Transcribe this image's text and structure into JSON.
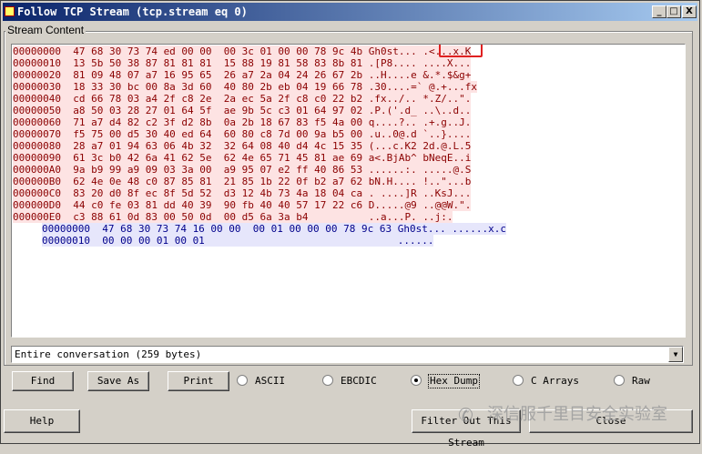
{
  "window": {
    "title": "Follow TCP Stream (tcp.stream eq 0)"
  },
  "caption_buttons": {
    "minimize": "_",
    "maximize": "□",
    "close": "X"
  },
  "stream": {
    "group_label": "Stream Content",
    "client_lines": [
      "00000000  47 68 30 73 74 ed 00 00  00 3c 01 00 00 78 9c 4b Gh0st... .<...x.K",
      "00000010  13 5b 50 38 87 81 81 81  15 88 19 81 58 83 8b 81 .[P8.... ....X...",
      "00000020  81 09 48 07 a7 16 95 65  26 a7 2a 04 24 26 67 2b ..H....e &.*.$&g+",
      "00000030  18 33 30 bc 00 8a 3d 60  40 80 2b eb 04 19 66 78 .30....=` @.+...fx",
      "00000040  cd 66 78 03 a4 2f c8 2e  2a ec 5a 2f c8 c0 22 b2 .fx../.. *.Z/..\".",
      "00000050  a8 50 03 28 27 01 64 5f  ae 9b 5c c3 01 64 97 02 .P.('.d_ ..\\..d..",
      "00000060  71 a7 d4 82 c2 3f d2 8b  0a 2b 18 67 83 f5 4a 00 q....?.. .+.g..J.",
      "00000070  f5 75 00 d5 30 40 ed 64  60 80 c8 7d 00 9a b5 00 .u..0@.d `..}....",
      "00000080  28 a7 01 94 63 06 4b 32  32 64 08 40 d4 4c 15 35 (...c.K2 2d.@.L.5",
      "00000090  61 3c b0 42 6a 41 62 5e  62 4e 65 71 45 81 ae 69 a<.BjAb^ bNeqE..i",
      "000000A0  9a b9 99 a9 09 03 3a 00  a9 95 07 e2 ff 40 86 53 ......:. .....@.S",
      "000000B0  62 4e 0e 48 c0 87 85 81  21 85 1b 22 0f b2 a7 62 bN.H.... !..\"...b",
      "000000C0  83 20 d0 8f ec 8f 5d 52  d3 12 4b 73 4a 18 04 ca . ....]R ..KsJ...",
      "000000D0  44 c0 fe 03 81 dd 40 39  90 fb 40 40 57 17 22 c6 D.....@9 ..@@W.\".",
      "000000E0  c3 88 61 0d 83 00 50 0d  00 d5 6a 3a b4          ..a...P. ..j:."
    ],
    "server_lines": [
      "00000000  47 68 30 73 74 16 00 00  00 01 00 00 00 78 9c 63 Gh0st... ......x.c",
      "00000010  00 00 00 01 00 01                                ......"
    ]
  },
  "conversation": {
    "selected": "Entire conversation (259 bytes)"
  },
  "buttons": {
    "find": "Find",
    "save_as": "Save As",
    "print": "Print",
    "help": "Help",
    "filter_out": "Filter Out This Stream",
    "close": "Close"
  },
  "formats": [
    {
      "label": "ASCII",
      "selected": false
    },
    {
      "label": "EBCDIC",
      "selected": false
    },
    {
      "label": "Hex Dump",
      "selected": true
    },
    {
      "label": "C Arrays",
      "selected": false
    },
    {
      "label": "Raw",
      "selected": false
    }
  ],
  "watermark": {
    "icon": "wechat-icon",
    "text": "深信服千里目安全实验室"
  },
  "colors": {
    "client_fg": "#8b0000",
    "client_bg": "#fde3e3",
    "server_fg": "#00008b",
    "server_bg": "#e6e6fb",
    "highlight": "#e02020"
  }
}
